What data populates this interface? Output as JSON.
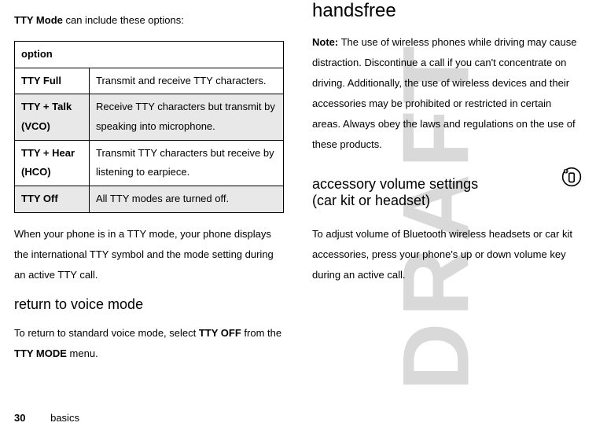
{
  "watermark": "DRAFT",
  "left": {
    "intro_prefix": "TTY Mode",
    "intro_suffix": " can include these options:",
    "table": {
      "header": "option",
      "rows": [
        {
          "label": "TTY Full",
          "desc": "Transmit and receive TTY characters."
        },
        {
          "label": "TTY + Talk (VCO)",
          "desc": "Receive TTY characters but transmit by speaking into microphone."
        },
        {
          "label": "TTY + Hear (HCO)",
          "desc": "Transmit TTY characters but receive by listening to earpiece."
        },
        {
          "label": "TTY Off",
          "desc": "All TTY modes are turned off."
        }
      ]
    },
    "post_table": "When your phone is in a TTY mode, your phone displays the international TTY symbol and the mode setting during an active TTY call.",
    "h2": "return to voice mode",
    "return_a": "To return to standard voice mode, select ",
    "return_b": "TTY OFF",
    "return_c": " from the ",
    "return_d": "TTY MODE",
    "return_e": " menu."
  },
  "right": {
    "h1": "handsfree",
    "note_label": "Note:",
    "note_body": " The use of wireless phones while driving may cause distraction. Discontinue a call if you can't concentrate on driving. Additionally, the use of wireless devices and their accessories may be prohibited or restricted in certain areas. Always obey the laws and regulations on the use of these products.",
    "h2_line1": "accessory volume settings",
    "h2_line2": "(car kit or headset)",
    "accessory_body": "To adjust volume of Bluetooth wireless headsets or car kit accessories, press your phone's up or down volume key during an active call."
  },
  "footer": {
    "page": "30",
    "section": "basics"
  }
}
